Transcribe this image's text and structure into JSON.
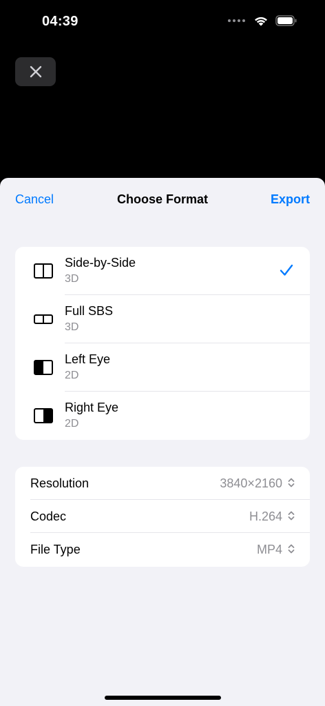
{
  "status_bar": {
    "time": "04:39"
  },
  "colors": {
    "accent": "#007aff",
    "secondary_text": "#8e8e93",
    "sheet_bg": "#f2f2f7"
  },
  "nav": {
    "cancel": "Cancel",
    "title": "Choose Format",
    "export": "Export"
  },
  "formats": [
    {
      "title": "Side-by-Side",
      "subtitle": "3D",
      "icon": "side-by-side-icon",
      "selected": true
    },
    {
      "title": "Full SBS",
      "subtitle": "3D",
      "icon": "full-sbs-icon",
      "selected": false
    },
    {
      "title": "Left Eye",
      "subtitle": "2D",
      "icon": "left-eye-icon",
      "selected": false
    },
    {
      "title": "Right Eye",
      "subtitle": "2D",
      "icon": "right-eye-icon",
      "selected": false
    }
  ],
  "settings": [
    {
      "label": "Resolution",
      "value": "3840×2160"
    },
    {
      "label": "Codec",
      "value": "H.264"
    },
    {
      "label": "File Type",
      "value": "MP4"
    }
  ]
}
